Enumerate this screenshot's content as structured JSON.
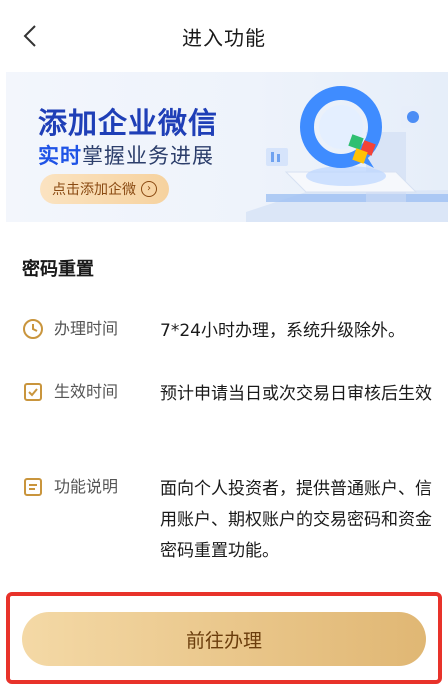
{
  "nav": {
    "title": "进入功能"
  },
  "banner": {
    "headline": "添加企业微信",
    "sub_highlight": "实时",
    "sub_rest": "掌握业务进展",
    "cta_label": "点击添加企微"
  },
  "section": {
    "title": "密码重置"
  },
  "rows": [
    {
      "icon": "clock-icon",
      "label": "办理时间",
      "value": "7*24小时办理，系统升级除外。"
    },
    {
      "icon": "calendar-check-icon",
      "label": "生效时间",
      "value": "预计申请当日或次交易日审核后生效"
    },
    {
      "icon": "document-icon",
      "label": "功能说明",
      "value": "面向个人投资者，提供普通账户、信用账户、期权账户的交易密码和资金密码重置功能。"
    }
  ],
  "action": {
    "label": "前往办理"
  },
  "colors": {
    "accent_gold": "#e8c487",
    "highlight_border": "#e8322a",
    "icon_gold": "#c9953d",
    "brand_blue": "#1f3fb7"
  }
}
